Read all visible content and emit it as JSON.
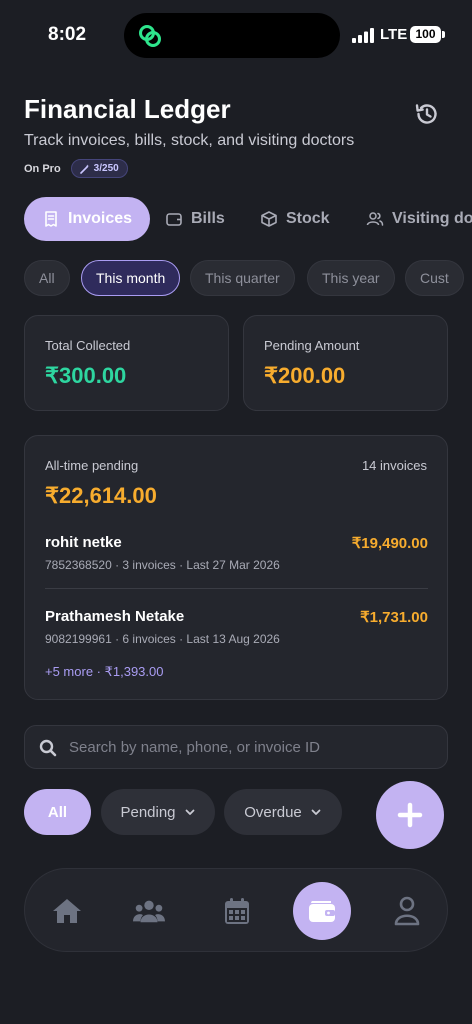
{
  "status_bar": {
    "time": "8:02",
    "network": "LTE",
    "battery": "100"
  },
  "header": {
    "title": "Financial Ledger",
    "subtitle": "Track invoices, bills, stock, and visiting doctors",
    "plan_label": "On Pro",
    "plan_badge": "3/250",
    "history_icon": "history-icon"
  },
  "tabs": [
    {
      "label": "Invoices",
      "icon": "receipt-icon",
      "active": true
    },
    {
      "label": "Bills",
      "icon": "wallet-icon",
      "active": false
    },
    {
      "label": "Stock",
      "icon": "box-icon",
      "active": false
    },
    {
      "label": "Visiting doc",
      "icon": "users-icon",
      "active": false
    }
  ],
  "date_filters": [
    {
      "label": "All",
      "active": false
    },
    {
      "label": "This month",
      "active": true
    },
    {
      "label": "This quarter",
      "active": false
    },
    {
      "label": "This year",
      "active": false
    },
    {
      "label": "Cust",
      "active": false
    }
  ],
  "stats": {
    "collected_label": "Total Collected",
    "collected_value": "₹300.00",
    "pending_label": "Pending Amount",
    "pending_value": "₹200.00"
  },
  "pending_summary": {
    "title": "All-time pending",
    "count": "14 invoices",
    "total": "₹22,614.00",
    "debtors": [
      {
        "name": "rohit netke",
        "amount": "₹19,490.00",
        "meta": "7852368520 · 3 invoices · Last 27 Mar 2026"
      },
      {
        "name": "Prathamesh Netake",
        "amount": "₹1,731.00",
        "meta": "9082199961 · 6 invoices · Last 13 Aug 2026"
      }
    ],
    "more": "+5 more · ₹1,393.00"
  },
  "search": {
    "placeholder": "Search by name, phone, or invoice ID",
    "value": ""
  },
  "status_filters": {
    "all": "All",
    "pending": "Pending",
    "overdue": "Overdue"
  },
  "fab_icon": "plus-icon",
  "bottom_nav": [
    {
      "icon": "home-icon",
      "active": false
    },
    {
      "icon": "group-icon",
      "active": false
    },
    {
      "icon": "calendar-icon",
      "active": false
    },
    {
      "icon": "wallet-icon",
      "active": true
    },
    {
      "icon": "profile-icon",
      "active": false
    }
  ],
  "colors": {
    "accent": "#c3b3f2",
    "collected": "#2ed6a0",
    "pending": "#f7ac2e",
    "link": "#a99cf2",
    "background": "#1c1e24"
  }
}
